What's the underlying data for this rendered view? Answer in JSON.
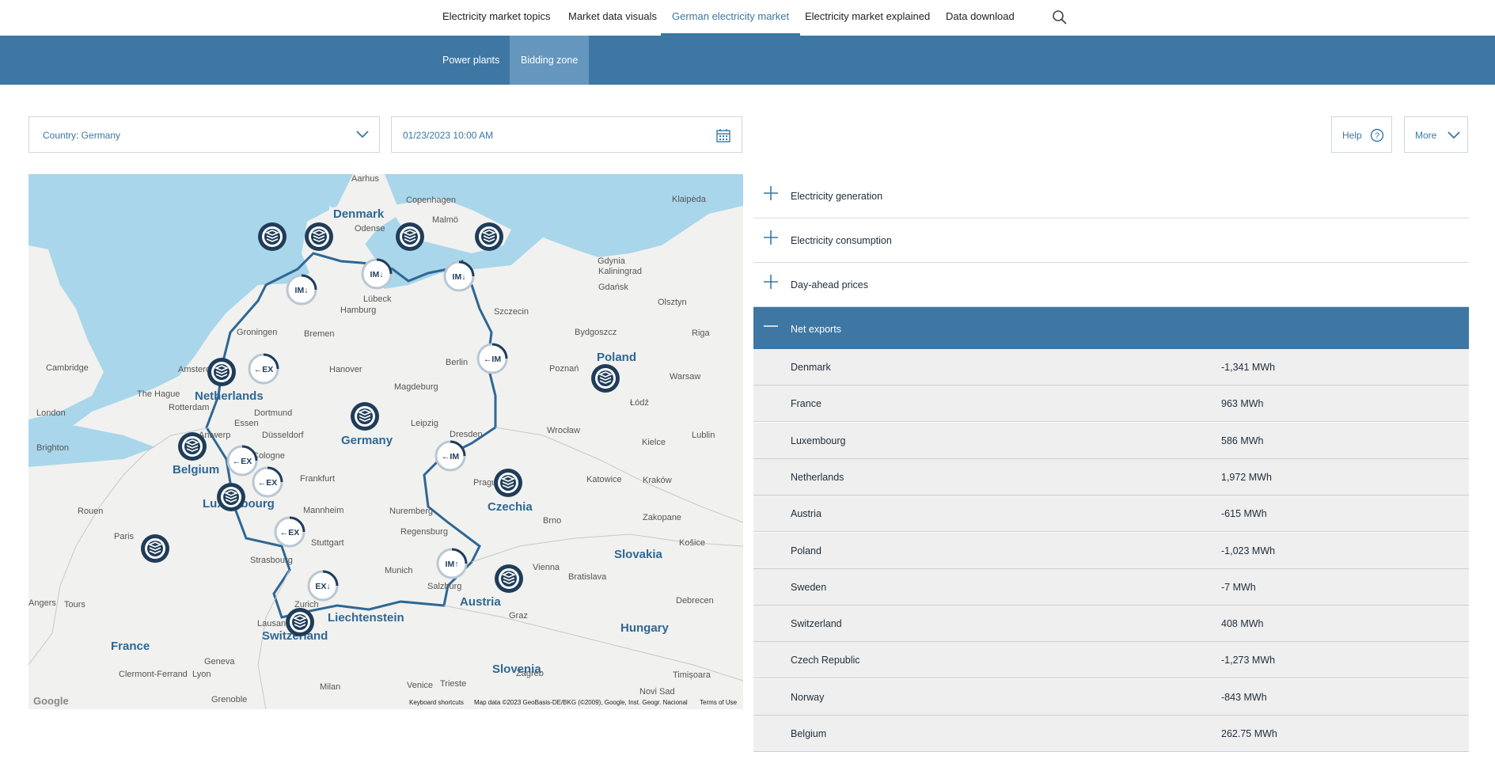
{
  "nav": {
    "items": [
      "Electricity market topics",
      "Market data visuals",
      "German electricity market",
      "Electricity market explained",
      "Data download"
    ],
    "active_index": 2
  },
  "subnav": {
    "items": [
      "Power plants",
      "Bidding zone"
    ],
    "active_index": 1
  },
  "filters": {
    "country": "Country: Germany",
    "datetime": "01/23/2023 10:00 AM"
  },
  "actions": {
    "help": "Help",
    "more": "More"
  },
  "map": {
    "countries": [
      "Denmark",
      "Netherlands",
      "Belgium",
      "Luxembourg",
      "Germany",
      "Poland",
      "Czechia",
      "Austria",
      "Slovakia",
      "Switzerland",
      "Liechtenstein",
      "France",
      "Hungary",
      "Slovenia"
    ],
    "cities": [
      "Aarhus",
      "Copenhagen",
      "Malmö",
      "Klaipėda",
      "Odense",
      "Gdynia",
      "Kaliningrad",
      "Gdańsk",
      "Olsztyn",
      "Lübeck",
      "Hamburg",
      "Bremen",
      "Groningen",
      "Szczecin",
      "Bydgoszcz",
      "Amsterdam",
      "Hanover",
      "Berlin",
      "Poznań",
      "Warsaw",
      "The Hague",
      "Magdeburg",
      "Rotterdam",
      "Dortmund",
      "Essen",
      "Leipzig",
      "Łódź",
      "London",
      "Brighton",
      "Antwerp",
      "Düsseldorf",
      "Cologne",
      "Dresden",
      "Wrocław",
      "Kielce",
      "Frankfurt",
      "Prague",
      "Katowice",
      "Kraków",
      "Rouen",
      "Paris",
      "Mannheim",
      "Nuremberg",
      "Brno",
      "Zakopane",
      "Košice",
      "Stuttgart",
      "Regensburg",
      "Strasbourg",
      "Munich",
      "Vienna",
      "Bratislava",
      "Zurich",
      "Salzburg",
      "Graz",
      "Debrecen",
      "Angers",
      "Tours",
      "Lausanne",
      "Geneva",
      "Lyon",
      "Clermont-Ferrand",
      "Milan",
      "Venice",
      "Trieste",
      "Zagreb",
      "Novi Sad",
      "Timișoara",
      "Grenoble",
      "Cambridge",
      "Lublin",
      "Riga"
    ],
    "google": "Google",
    "attribution": [
      "Keyboard shortcuts",
      "Map data ©2023 GeoBasis-DE/BKG (©2009), Google, Inst. Geogr. Nacional",
      "Terms of Use"
    ],
    "markers": {
      "import": "IM",
      "export": "EX"
    }
  },
  "accordion": [
    {
      "label": "Electricity generation",
      "open": false
    },
    {
      "label": "Electricity consumption",
      "open": false
    },
    {
      "label": "Day-ahead prices",
      "open": false
    },
    {
      "label": "Net exports",
      "open": true
    }
  ],
  "net_exports": [
    {
      "country": "Denmark",
      "value": "-1,341 MWh"
    },
    {
      "country": "France",
      "value": "963 MWh"
    },
    {
      "country": "Luxembourg",
      "value": "586 MWh"
    },
    {
      "country": "Netherlands",
      "value": "1,972 MWh"
    },
    {
      "country": "Austria",
      "value": "-615 MWh"
    },
    {
      "country": "Poland",
      "value": "-1,023 MWh"
    },
    {
      "country": "Sweden",
      "value": "-7 MWh"
    },
    {
      "country": "Switzerland",
      "value": "408 MWh"
    },
    {
      "country": "Czech Republic",
      "value": "-1,273 MWh"
    },
    {
      "country": "Norway",
      "value": "-843 MWh"
    },
    {
      "country": "Belgium",
      "value": "262.75 MWh"
    }
  ],
  "colors": {
    "accent": "#3e77a3",
    "sea": "#a9d6ea",
    "land": "#f1f1ef",
    "border": "#2e6794",
    "marker": "#1f3d5a"
  }
}
